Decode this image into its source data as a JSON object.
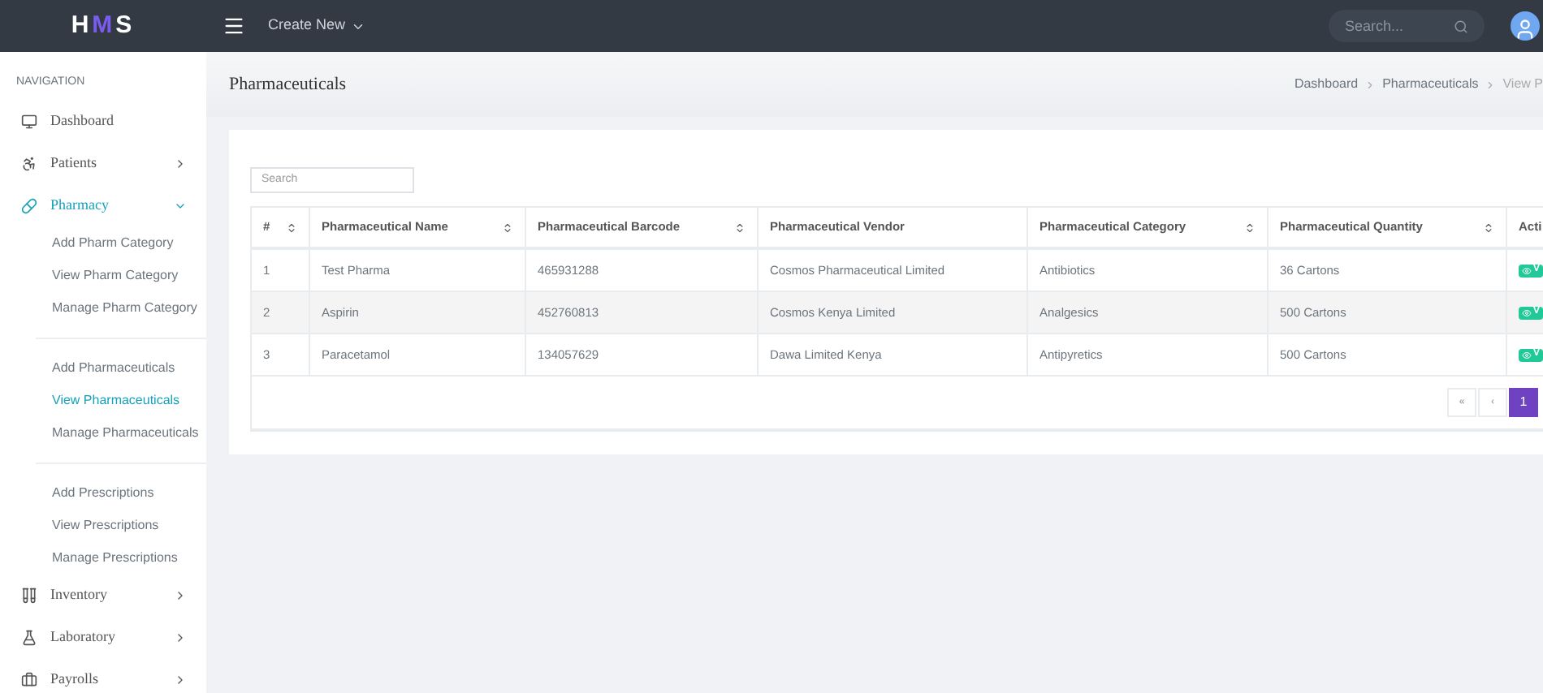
{
  "header": {
    "logo": "HMS",
    "create_menu": "Create New",
    "search": {
      "placeholder": "Search..."
    }
  },
  "sidebar": {
    "heading": "NAVIGATION",
    "items": [
      {
        "label": "Dashboard",
        "kind": "link",
        "selected": false
      },
      {
        "label": "Patients",
        "kind": "menu",
        "selected": false,
        "expanded": false
      },
      {
        "label": "Pharmacy",
        "kind": "menu",
        "selected": true,
        "expanded": true,
        "groups": [
          [
            {
              "label": "Add Pharm Category",
              "selected": false
            },
            {
              "label": "View Pharm Category",
              "selected": false
            },
            {
              "label": "Manage Pharm Category",
              "selected": false
            }
          ],
          [
            {
              "label": "Add Pharmaceuticals",
              "selected": false
            },
            {
              "label": "View Pharmaceuticals",
              "selected": true
            },
            {
              "label": "Manage Pharmaceuticals",
              "selected": false
            }
          ],
          [
            {
              "label": "Add Prescriptions",
              "selected": false
            },
            {
              "label": "View Prescriptions",
              "selected": false
            },
            {
              "label": "Manage Prescriptions",
              "selected": false
            }
          ]
        ]
      },
      {
        "label": "Inventory",
        "kind": "menu",
        "selected": false,
        "expanded": false
      },
      {
        "label": "Laboratory",
        "kind": "menu",
        "selected": false,
        "expanded": false
      },
      {
        "label": "Payrolls",
        "kind": "menu",
        "selected": false,
        "expanded": false
      }
    ]
  },
  "page": {
    "title": "Pharmaceuticals",
    "breadcrumb": [
      "Dashboard",
      "Pharmaceuticals",
      "View P"
    ]
  },
  "table": {
    "search": {
      "placeholder": "Search"
    },
    "columns": [
      {
        "label": "#",
        "sortable": true
      },
      {
        "label": "Pharmaceutical Name",
        "sortable": true
      },
      {
        "label": "Pharmaceutical Barcode",
        "sortable": true
      },
      {
        "label": "Pharmaceutical Vendor",
        "sortable": false
      },
      {
        "label": "Pharmaceutical Category",
        "sortable": true
      },
      {
        "label": "Pharmaceutical Quantity",
        "sortable": true
      },
      {
        "label": "Acti"
      }
    ],
    "rows": [
      {
        "cells": [
          "1",
          "Test Pharma",
          "465931288",
          "Cosmos Pharmaceutical Limited",
          "Antibiotics",
          "36 Cartons"
        ],
        "action": "V"
      },
      {
        "cells": [
          "2",
          "Aspirin",
          "452760813",
          "Cosmos Kenya Limited",
          "Analgesics",
          "500 Cartons"
        ],
        "action": "V"
      },
      {
        "cells": [
          "3",
          "Paracetamol",
          "134057629",
          "Dawa Limited Kenya",
          "Antipyretics",
          "500 Cartons"
        ],
        "action": "V"
      }
    ],
    "pagination": [
      {
        "label": "«",
        "selected": false
      },
      {
        "label": "‹",
        "selected": false
      },
      {
        "label": "1",
        "selected": true
      }
    ]
  }
}
